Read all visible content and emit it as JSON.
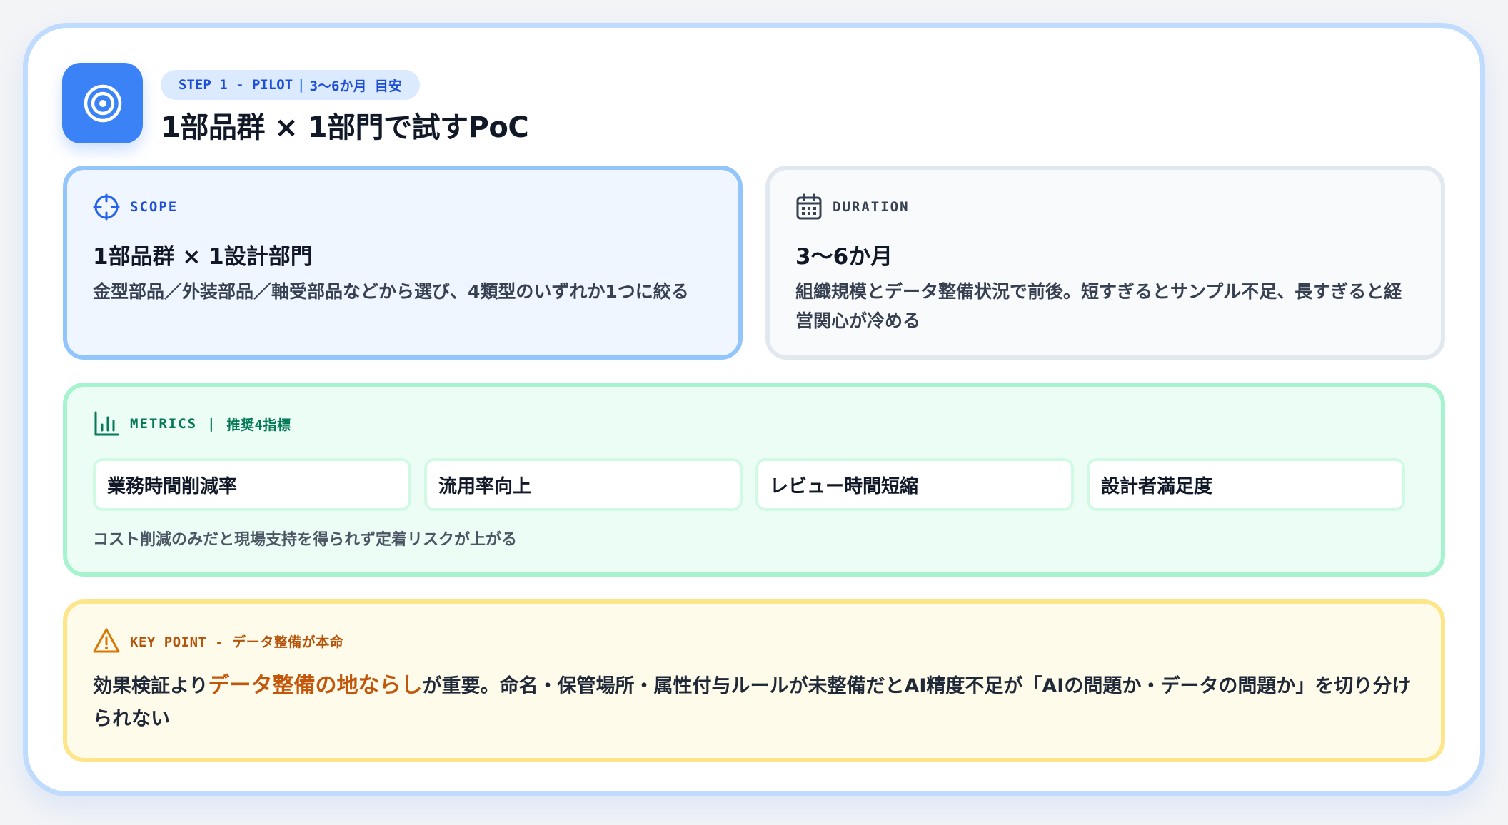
{
  "header": {
    "icon": "target-icon",
    "step_label": "STEP 1 - PILOT",
    "step_separator": "|",
    "step_period": "3〜6か月 目安",
    "title": "1部品群 × 1部門で試すPoC"
  },
  "scope": {
    "icon": "crosshair-icon",
    "label": "SCOPE",
    "heading": "1部品群 × 1設計部門",
    "description": "金型部品／外装部品／軸受部品などから選び、4類型のいずれか1つに絞る"
  },
  "duration": {
    "icon": "calendar-icon",
    "label": "DURATION",
    "heading": "3〜6か月",
    "description": "組織規模とデータ整備状況で前後。短すぎるとサンプル不足、長すぎると経営関心が冷める"
  },
  "metrics": {
    "icon": "bar-chart-icon",
    "label": "METRICS",
    "separator": "|",
    "sublabel": "推奨4指標",
    "items": [
      "業務時間削減率",
      "流用率向上",
      "レビュー時間短縮",
      "設計者満足度"
    ],
    "note": "コスト削減のみだと現場支持を得られず定着リスクが上がる"
  },
  "keypoint": {
    "icon": "warning-icon",
    "label": "KEY POINT - データ整備が本命",
    "text_before": "効果検証より",
    "text_highlight": "データ整備の地ならし",
    "text_after": "が重要。命名・保管場所・属性付与ルールが未整備だとAI精度不足が「AIの問題か・データの問題か」を切り分けられない"
  },
  "colors": {
    "accent_blue": "#3b82f6",
    "metrics_green": "#047857",
    "keypoint_orange": "#c2570c"
  }
}
